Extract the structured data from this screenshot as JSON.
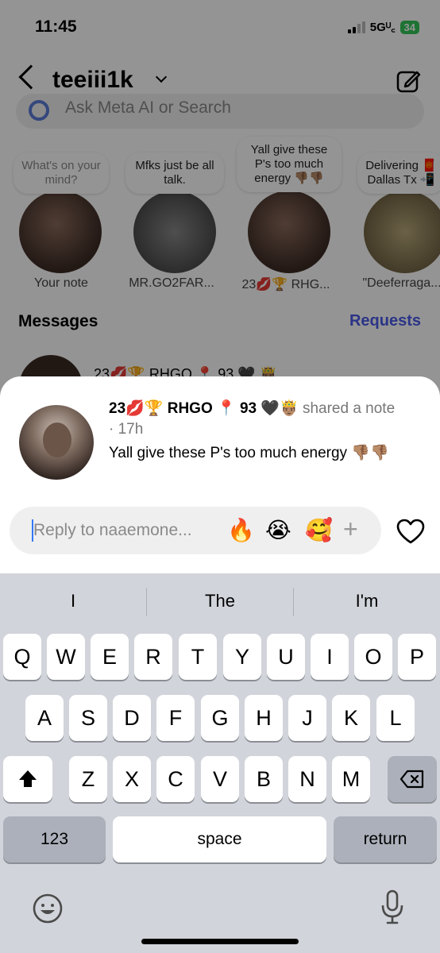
{
  "status_bar": {
    "time": "11:45",
    "network": "5Gᵁ꜀",
    "battery": "34"
  },
  "header": {
    "username": "teeiii1k"
  },
  "search": {
    "placeholder": "Ask Meta AI or Search"
  },
  "notes": [
    {
      "bubble": "What's on your mind?",
      "name": "Your note"
    },
    {
      "bubble": "Mfks just be all talk.",
      "name": "MR.GO2FAR..."
    },
    {
      "bubble": "Yall give these P's too much energy 👎🏽👎🏽",
      "name": "23💋🏆 RHG..."
    },
    {
      "bubble": "Delivering 🧧 Dallas Tx 📲",
      "name": "\"Deeferraga..."
    }
  ],
  "messages": {
    "title": "Messages",
    "requests": "Requests",
    "first_row": "23💋🏆 RHGO 📍 93 🖤 🤴🏽"
  },
  "sheet": {
    "author": "23💋🏆 RHGO 📍 93 🖤🤴🏽",
    "shared_text": "shared a note",
    "time": "· 17h",
    "note_text": "Yall give these P's too much energy 👎🏽👎🏽",
    "reply_placeholder": "Reply to naaemone...",
    "quick_reactions": [
      "🔥",
      "😭",
      "🥰"
    ],
    "plus": "+"
  },
  "keyboard": {
    "suggestions": [
      "I",
      "The",
      "I'm"
    ],
    "row1": [
      "Q",
      "W",
      "E",
      "R",
      "T",
      "Y",
      "U",
      "I",
      "O",
      "P"
    ],
    "row2": [
      "A",
      "S",
      "D",
      "F",
      "G",
      "H",
      "J",
      "K",
      "L"
    ],
    "row3": [
      "Z",
      "X",
      "C",
      "V",
      "B",
      "N",
      "M"
    ],
    "numbers": "123",
    "space": "space",
    "return": "return"
  }
}
